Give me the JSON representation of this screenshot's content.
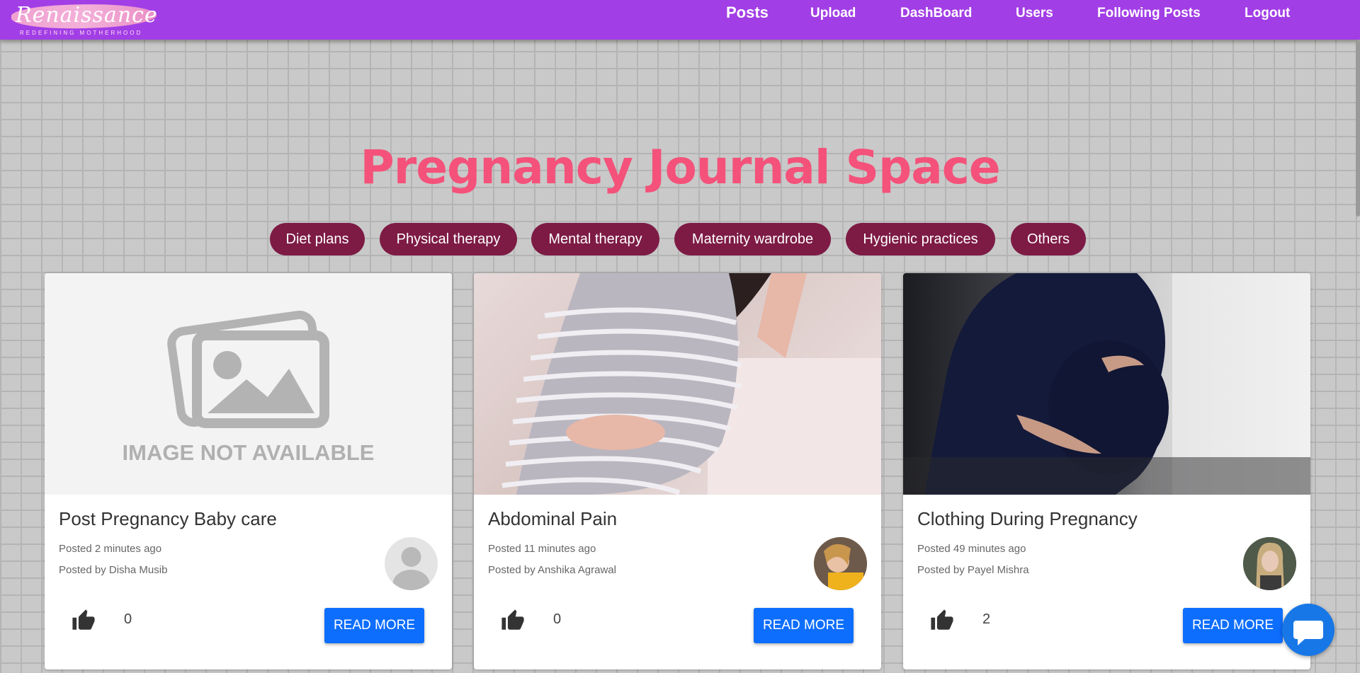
{
  "brand": {
    "name": "Renaissance",
    "tagline": "REDEFINING MOTHERHOOD"
  },
  "nav": {
    "items": [
      {
        "label": "Posts"
      },
      {
        "label": "Upload"
      },
      {
        "label": "DashBoard"
      },
      {
        "label": "Users"
      },
      {
        "label": "Following Posts"
      },
      {
        "label": "Logout"
      }
    ]
  },
  "page": {
    "title": "Pregnancy Journal Space"
  },
  "categories": [
    "Diet plans",
    "Physical therapy",
    "Mental therapy",
    "Maternity wardrobe",
    "Hygienic practices",
    "Others"
  ],
  "posts": [
    {
      "title": "Post Pregnancy Baby care",
      "posted": "Posted 2 minutes ago",
      "author": "Posted by Disha Musib",
      "likes": "0",
      "read_more": "READ MORE",
      "image_text": "IMAGE NOT AVAILABLE"
    },
    {
      "title": "Abdominal Pain",
      "posted": "Posted 11 minutes ago",
      "author": "Posted by Anshika Agrawal",
      "likes": "0",
      "read_more": "READ MORE"
    },
    {
      "title": "Clothing During Pregnancy",
      "posted": "Posted 49 minutes ago",
      "author": "Posted by Payel Mishra",
      "likes": "2",
      "read_more": "READ MORE"
    }
  ],
  "colors": {
    "nav": "#a23ee6",
    "title": "#f4527a",
    "category": "#7d1b45",
    "button": "#0d6efd"
  }
}
